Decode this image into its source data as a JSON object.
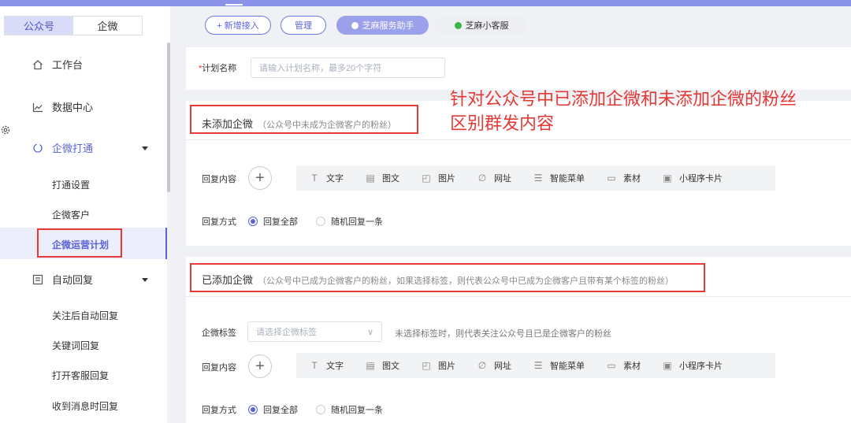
{
  "header": {
    "segments": [
      "公众号",
      "企微"
    ]
  },
  "sidebar": {
    "items": [
      {
        "label": "工作台",
        "icon": "home-icon"
      },
      {
        "label": "数据中心",
        "icon": "chart-line-icon"
      },
      {
        "label": "企微打通",
        "icon": "sync-icon"
      },
      {
        "label": "自动回复",
        "icon": "message-box-icon"
      }
    ],
    "sub_qiwei": [
      "打通设置",
      "企微客户",
      "企微运营计划"
    ],
    "sub_reply": [
      "关注后自动回复",
      "关键词回复",
      "打开客服回复",
      "收到消息时回复"
    ]
  },
  "toolbar": {
    "add_label": "+ 新增接入",
    "manage_label": "管理",
    "assistant_label": "芝麻服务助手",
    "bot_label": "芝麻小客服"
  },
  "form": {
    "plan_name_label": "计划名称",
    "plan_name_required": "*",
    "plan_name_placeholder": "请输入计划名称，最多20个字符"
  },
  "annotation": {
    "line1": "针对公众号中已添加企微和未添加企微的粉丝",
    "line2": "区别群发内容"
  },
  "section_unadded": {
    "title": "未添加企微",
    "hint": "（公众号中未成为企微客户的粉丝）",
    "content_label": "回复内容",
    "mode_label": "回复方式",
    "mode_all": "回复全部",
    "mode_random": "随机回复一条"
  },
  "section_added": {
    "title": "已添加企微",
    "hint": "（公众号中已成为企微客户的粉丝，如果选择标签，则代表公众号中已成为企微客户且带有某个标签的粉丝）",
    "tag_label": "企微标签",
    "tag_placeholder": "请选择企微标签",
    "tag_hint": "未选择标签时，则代表关注公众号且已是企微客户的粉丝",
    "content_label": "回复内容",
    "mode_label": "回复方式",
    "mode_all": "回复全部",
    "mode_random": "随机回复一条"
  },
  "content_types": [
    {
      "label": "文字",
      "icon": "text-icon"
    },
    {
      "label": "图文",
      "icon": "article-icon"
    },
    {
      "label": "图片",
      "icon": "image-icon"
    },
    {
      "label": "网址",
      "icon": "link-icon"
    },
    {
      "label": "智能菜单",
      "icon": "menu-list-icon"
    },
    {
      "label": "素材",
      "icon": "material-icon"
    },
    {
      "label": "小程序卡片",
      "icon": "mini-program-icon"
    }
  ],
  "colors": {
    "accent": "#5b63d6",
    "annotation_red": "#e53935",
    "topbar": "#8b93e8"
  }
}
